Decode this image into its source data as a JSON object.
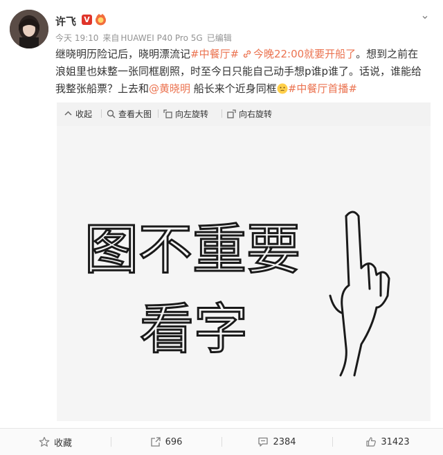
{
  "post": {
    "username": "许飞",
    "verified_badge": "V",
    "meta": {
      "time": "今天 19:10",
      "source_prefix": "来自",
      "source": "HUAWEI P40 Pro 5G",
      "edited": "已编辑"
    },
    "text": {
      "line1_plain": "继晓明历险记后，晓明漂流记",
      "hashtag1": "#中餐厅#",
      "link_text": "今晚22:00就要开船了",
      "line1_tail": "。想到之前在",
      "line2": "浪姐里也妹整一张同框剧照，时至今日只能自己动手想p谁p谁了。话说，谁能给",
      "line3_plain": "我整张船票？上去和",
      "mention": "@黄晓明",
      "line3_mid": " 船长来个近身同框",
      "hashtag2": "#中餐厅首播#"
    },
    "image_toolbar": {
      "collapse": "收起",
      "view_large": "查看大图",
      "rotate_left": "向左旋转",
      "rotate_right": "向右旋转"
    },
    "image_text": {
      "line1": "图不重要",
      "line2": "看字"
    },
    "actions": {
      "favorite": "收藏",
      "repost": "696",
      "comment": "2384",
      "like": "31423"
    }
  },
  "colors": {
    "link": "#eb7350",
    "badge_red": "#e0352b",
    "meta_gray": "#939393"
  }
}
